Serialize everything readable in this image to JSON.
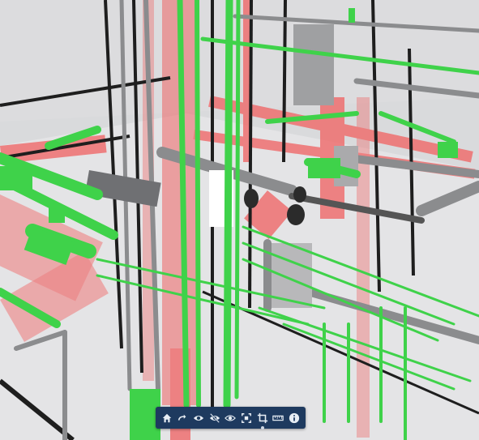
{
  "viewer": {
    "scene": "3d-mep-model",
    "colors": {
      "background": "#d9dadc",
      "pipe_green": "#3fd24a",
      "duct_red": "#f06060",
      "pipe_gray": "#8b8c8e",
      "dark_pipe": "#2a2a2a",
      "toolbar_bg": "#1e3a5f",
      "toolbar_icon": "#e8eef5"
    },
    "toolbar": {
      "buttons": [
        {
          "id": "home",
          "icon": "home-icon"
        },
        {
          "id": "redo",
          "icon": "redo-icon"
        },
        {
          "id": "show",
          "icon": "eye-icon"
        },
        {
          "id": "hide",
          "icon": "eye-off-icon"
        },
        {
          "id": "isolate",
          "icon": "eye-outline-icon"
        },
        {
          "id": "fit",
          "icon": "fit-to-view-icon"
        },
        {
          "id": "section",
          "icon": "crop-icon",
          "active": true
        },
        {
          "id": "measure",
          "icon": "ruler-icon"
        },
        {
          "id": "info",
          "icon": "info-icon"
        }
      ]
    }
  }
}
